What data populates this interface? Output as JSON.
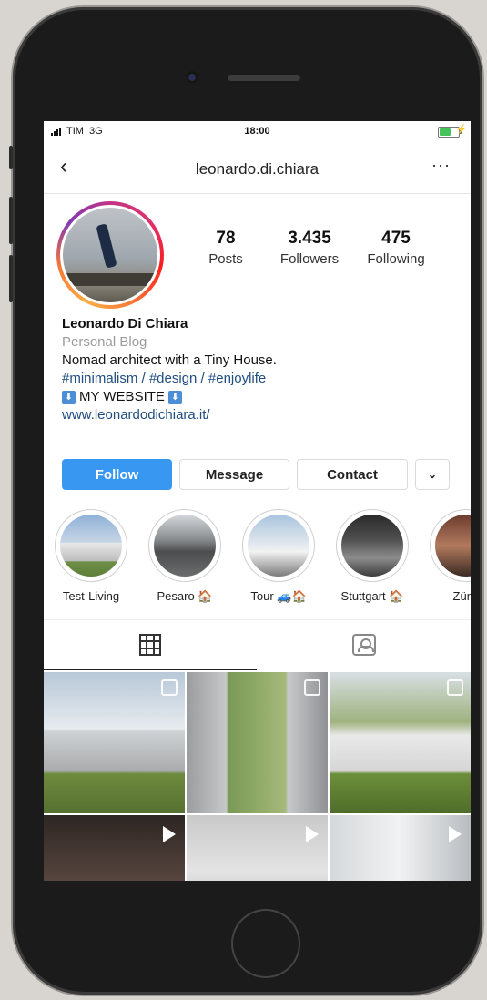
{
  "status_bar": {
    "carrier": "TIM",
    "network": "3G",
    "time": "18:00",
    "battery_percent": 60
  },
  "header": {
    "username": "leonardo.di.chiara",
    "back_icon": "chevron-left-icon",
    "more_icon": "more-horizontal-icon"
  },
  "stats": [
    {
      "value": "78",
      "label": "Posts"
    },
    {
      "value": "3.435",
      "label": "Followers"
    },
    {
      "value": "475",
      "label": "Following"
    }
  ],
  "bio": {
    "name": "Leonardo Di Chiara",
    "category": "Personal Blog",
    "description": "Nomad architect with a Tiny House.",
    "tags": "#minimalism / #design / #enjoylife",
    "website_label": "MY WEBSITE",
    "url": "www.leonardodichiara.it/"
  },
  "actions": {
    "follow": "Follow",
    "message": "Message",
    "contact": "Contact",
    "dropdown_icon": "chevron-down-icon"
  },
  "highlights": [
    {
      "label": "Test-Living"
    },
    {
      "label": "Pesaro 🏠"
    },
    {
      "label": "Tour 🚙🏠"
    },
    {
      "label": "Stuttgart 🏠"
    },
    {
      "label": "Züric"
    }
  ],
  "tabs": [
    {
      "name": "grid",
      "icon": "grid-icon",
      "active": true
    },
    {
      "name": "tagged",
      "icon": "tagged-icon",
      "active": false
    }
  ],
  "posts": [
    {
      "type": "carousel"
    },
    {
      "type": "carousel"
    },
    {
      "type": "carousel"
    },
    {
      "type": "video"
    },
    {
      "type": "video"
    },
    {
      "type": "video"
    }
  ],
  "colors": {
    "accent": "#3897f0",
    "link": "#1f4d80",
    "muted": "#9b9b9b"
  }
}
